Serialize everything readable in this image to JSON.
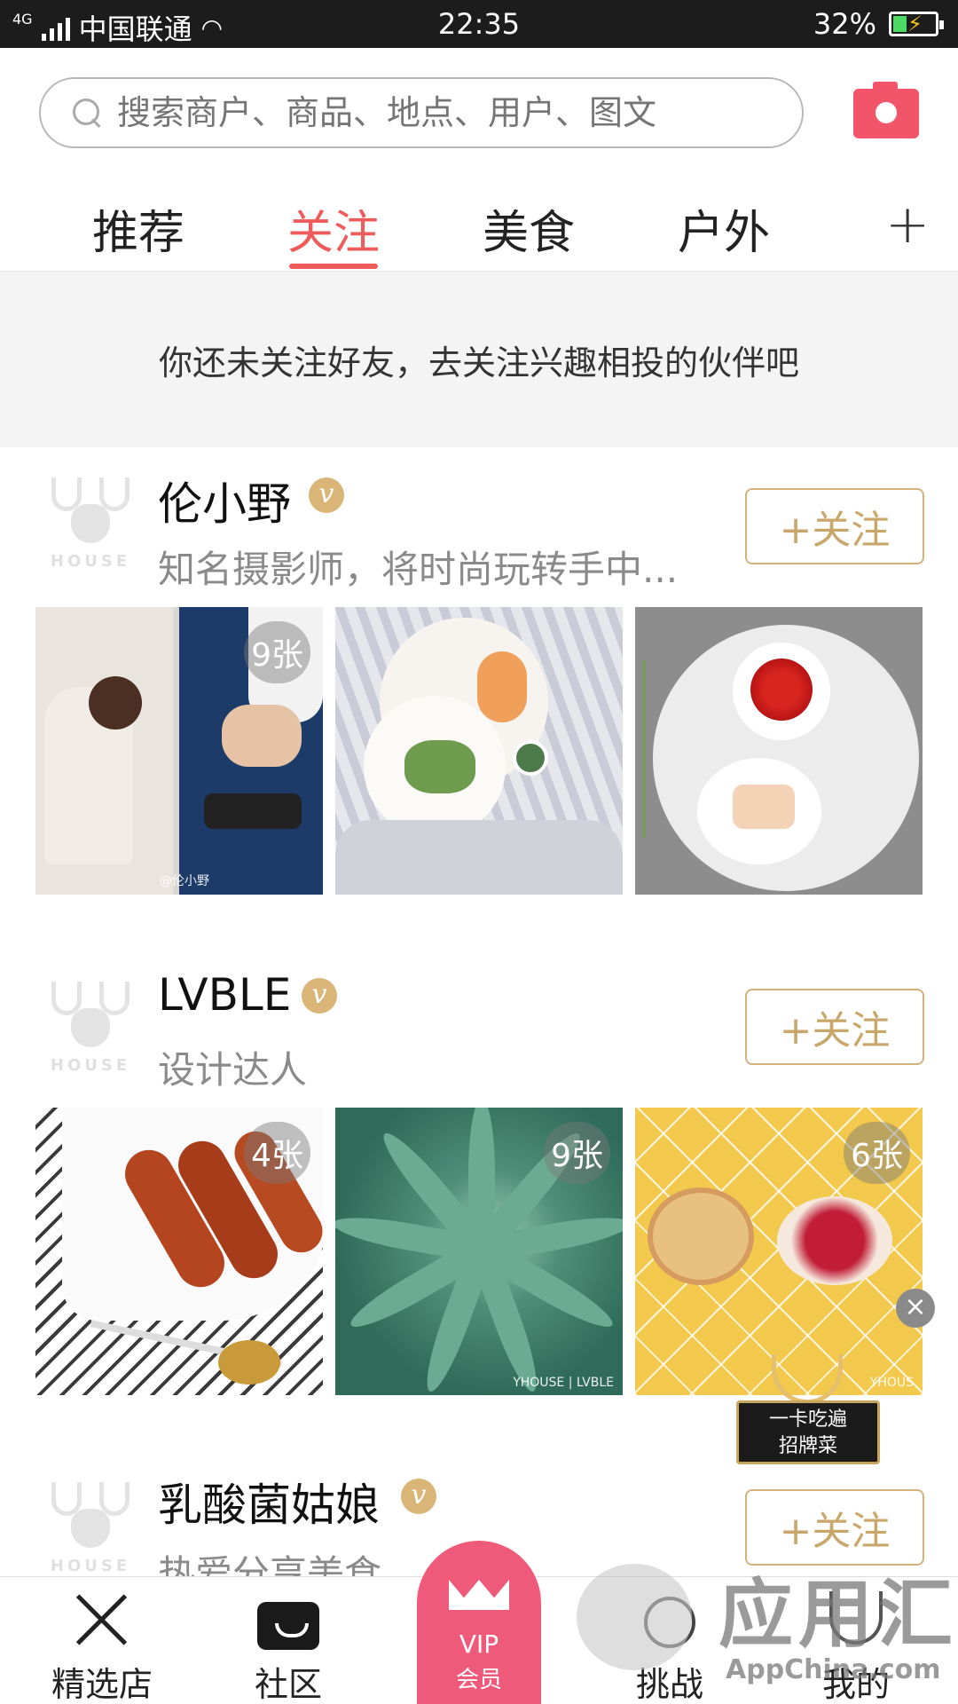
{
  "status_bar": {
    "network": "4G",
    "carrier": "中国联通",
    "time": "22:35",
    "battery": "32%",
    "battery_level": 0.32
  },
  "search": {
    "placeholder": "搜索商户、商品、地点、用户、图文",
    "camera_icon": "camera-icon"
  },
  "tabs": {
    "items": [
      "推荐",
      "关注",
      "美食",
      "户外"
    ],
    "active_index": 1,
    "add": "+"
  },
  "notice": "你还未关注好友，去关注兴趣相投的伙伴吧",
  "follow_label": "+关注",
  "users": [
    {
      "name": "伦小野",
      "verified": "v",
      "desc": "知名摄影师，将时尚玩转手中...",
      "avatar_text": "HOUSE",
      "photos": [
        {
          "badge": "9张",
          "watermark": "@伦小野"
        },
        {
          "badge": "",
          "watermark": ""
        },
        {
          "badge": "",
          "watermark": ""
        }
      ]
    },
    {
      "name": "LVBLE",
      "verified": "v",
      "desc": "设计达人",
      "avatar_text": "HOUSE",
      "photos": [
        {
          "badge": "4张",
          "watermark": ""
        },
        {
          "badge": "9张",
          "watermark": "YHOUSE | LVBLE"
        },
        {
          "badge": "6张",
          "watermark": "YHOUS"
        }
      ]
    },
    {
      "name": "乳酸菌姑娘",
      "verified": "v",
      "desc": "热爱分享美食",
      "avatar_text": "HOUSE"
    }
  ],
  "promo": {
    "line1": "一卡吃遍",
    "line2": "招牌菜",
    "close": "×"
  },
  "bottom_nav": {
    "items": [
      "精选店",
      "社区",
      "挑战",
      "我的"
    ],
    "vip_label": "VIP",
    "vip_sub": "会员"
  },
  "watermark": {
    "big": "应用汇",
    "small": "AppChina.com"
  },
  "colors": {
    "accent": "#ef5a5a",
    "gold": "#d2b17c",
    "vip": "#ef5a7a"
  }
}
